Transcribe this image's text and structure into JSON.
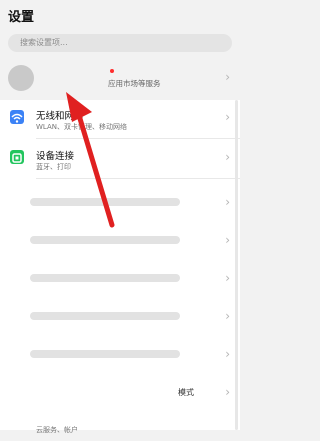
{
  "header": {
    "title": "设置"
  },
  "search": {
    "placeholder": "搜索设置项..."
  },
  "account": {
    "subtitle": "应用市场等服务"
  },
  "rows": [
    {
      "label": "无线和网络",
      "sub": "WLAN、双卡管理、移动网络",
      "icon_color": "#3b82f6",
      "icon": "wifi-icon"
    },
    {
      "label": "设备连接",
      "sub": "蓝牙、打印",
      "icon_color": "#22c55e",
      "icon": "device-link-icon"
    }
  ],
  "partial": {
    "mode_text": "模式",
    "cloud_text": "云服务、帐户"
  },
  "colors": {
    "arrow": "#e02020",
    "accent_blue": "#3b82f6",
    "accent_green": "#22c55e"
  }
}
